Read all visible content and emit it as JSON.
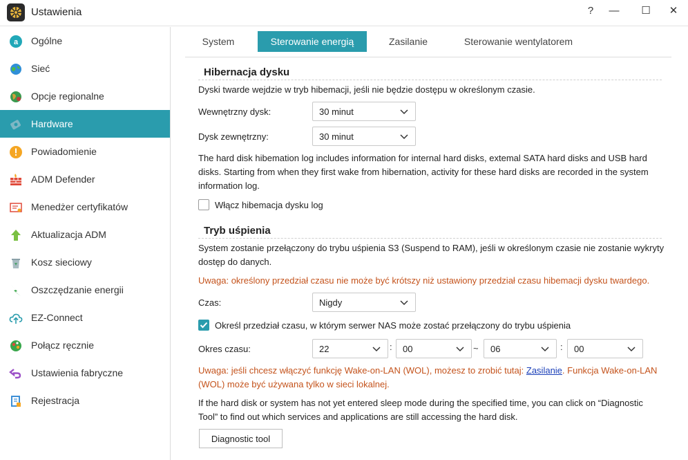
{
  "window": {
    "title": "Ustawienia",
    "help_glyph": "?",
    "minimize_glyph": "—",
    "maximize_glyph": "☐",
    "close_glyph": "✕"
  },
  "sidebar": {
    "items": [
      {
        "label": "Ogólne",
        "icon": "general-icon"
      },
      {
        "label": "Sieć",
        "icon": "network-globe-icon"
      },
      {
        "label": "Opcje regionalne",
        "icon": "regional-options-icon"
      },
      {
        "label": "Hardware",
        "icon": "hardware-icon"
      },
      {
        "label": "Powiadomienie",
        "icon": "notification-icon"
      },
      {
        "label": "ADM Defender",
        "icon": "firewall-icon"
      },
      {
        "label": "Menedżer certyfikatów",
        "icon": "certificate-icon"
      },
      {
        "label": "Aktualizacja ADM",
        "icon": "update-arrow-icon"
      },
      {
        "label": "Kosz sieciowy",
        "icon": "recycle-bin-icon"
      },
      {
        "label": "Oszczędzanie energii",
        "icon": "energy-saving-icon"
      },
      {
        "label": "EZ-Connect",
        "icon": "cloud-connect-icon"
      },
      {
        "label": "Połącz ręcznie",
        "icon": "manual-connect-icon"
      },
      {
        "label": "Ustawienia fabryczne",
        "icon": "factory-reset-icon"
      },
      {
        "label": "Rejestracja",
        "icon": "registration-icon"
      }
    ],
    "active_index": 3
  },
  "tabs": [
    "System",
    "Sterowanie energią",
    "Zasilanie",
    "Sterowanie wentylatorem"
  ],
  "active_tab": 1,
  "hibernation": {
    "title": "Hibernacja dysku",
    "description": "Dyski twarde wejdzie w tryb hibemacji, jeśli nie będzie dostępu w określonym czasie.",
    "internal_label": "Wewnętrzny dysk:",
    "internal_value": "30 minut",
    "external_label": "Dysk zewnętrzny:",
    "external_value": "30 minut",
    "log_info_line1": "The hard disk hibemation log includes information for internal hard disks, extemal SATA hard disks and USB hard",
    "log_info_line2": "disks. Starting from when they first wake from hibernation, activity for these hard disks are recorded in the system",
    "log_info_line3": "information log.",
    "log_checkbox_label": "Włącz hibemacja dysku log",
    "log_checkbox_checked": false
  },
  "sleep": {
    "title": "Tryb uśpienia",
    "description_line1": "System zostanie przełączony do trybu uśpienia S3 (Suspend to RAM), jeśli w określonym czasie nie zostanie wykryty",
    "description_line2": "dostęp do danych.",
    "warning": "Uwaga: określony przedział czasu nie może być krótszy niż ustawiony przedział czasu hibemacji dysku twardego.",
    "time_label": "Czas:",
    "time_value": "Nigdy",
    "schedule_checkbox_label": "Określ przedział czasu, w którym serwer NAS może zostać przełączony do trybu uśpienia",
    "schedule_checkbox_checked": true,
    "period_label": "Okres czasu:",
    "start_hour": "22",
    "start_minute": "00",
    "end_hour": "06",
    "end_minute": "00",
    "colon": ":",
    "tilde": "~",
    "wol_prefix": "Uwaga: jeśli chcesz włączyć funkcję Wake-on-LAN (WOL), możesz to zrobić tutaj: ",
    "wol_link": "Zasilanie",
    "wol_suffix": ". Funkcja Wake-on-LAN",
    "wol_line2": "(WOL) może być używana tylko w sieci lokalnej.",
    "diag_line1": "If the hard disk or system has not yet entered sleep mode during the specified time, you can click on “Diagnostic",
    "diag_line2": "Tool” to find out which services and applications are still accessing the hard disk.",
    "diag_button": "Diagnostic tool"
  },
  "colors": {
    "accent": "#2a9cad",
    "warning_text": "#c4531c",
    "link": "#1a3fb8"
  }
}
